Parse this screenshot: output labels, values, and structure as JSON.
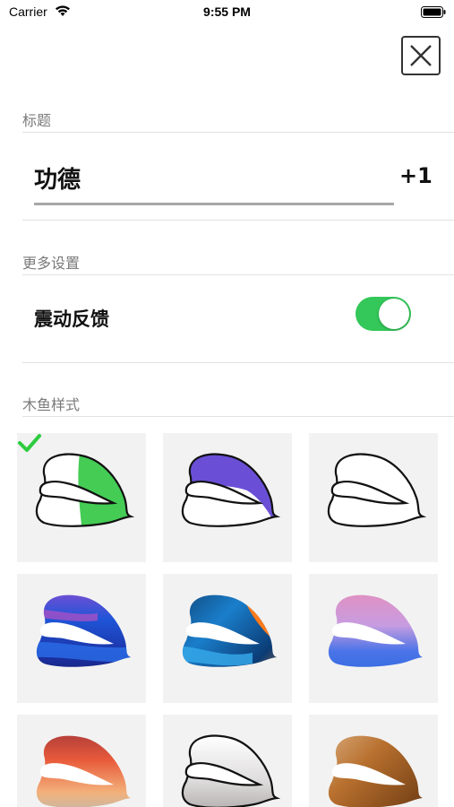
{
  "status_bar": {
    "carrier": "Carrier",
    "time": "9:55 PM"
  },
  "sections": {
    "title_header": "标题",
    "more_settings_header": "更多设置",
    "style_header": "木鱼样式"
  },
  "title_field": {
    "value": "功德",
    "suffix": "+1"
  },
  "vibration": {
    "label": "震动反馈",
    "enabled": true
  },
  "styles": {
    "selected_index": 0,
    "items": [
      "green-half-fish-icon",
      "purple-top-fish-icon",
      "outline-fish-icon",
      "blue-wave-fish-icon",
      "orange-blue-wave-fish-icon",
      "pink-gradient-fish-icon",
      "sunset-gradient-fish-icon",
      "silver-fish-icon",
      "bronze-fish-icon"
    ]
  },
  "colors": {
    "accent_green": "#34c759",
    "check_green": "#2ecc40",
    "tile_bg": "#f2f2f2",
    "header_gray": "#7a7a7a"
  }
}
